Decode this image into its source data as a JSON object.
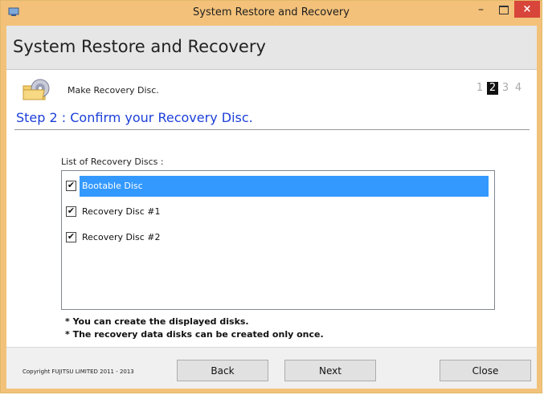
{
  "window": {
    "title": "System Restore and Recovery",
    "minimize_label": "–",
    "close_label": "×"
  },
  "header": {
    "heading": "System Restore and Recovery"
  },
  "section": {
    "label": "Make Recovery Disc.",
    "icon": "disc-folder-icon"
  },
  "steps": [
    {
      "label": "1",
      "active": false
    },
    {
      "label": "2",
      "active": true
    },
    {
      "label": "3",
      "active": false
    },
    {
      "label": "4",
      "active": false
    }
  ],
  "step_title": "Step 2 : Confirm your Recovery Disc.",
  "list": {
    "label": "List of Recovery Discs :",
    "items": [
      {
        "label": "Bootable Disc",
        "checked": true,
        "selected": true
      },
      {
        "label": "Recovery Disc #1",
        "checked": true,
        "selected": false
      },
      {
        "label": "Recovery Disc #2",
        "checked": true,
        "selected": false
      }
    ]
  },
  "notes": [
    "* You can create the displayed disks.",
    "* The recovery data disks can be created only once."
  ],
  "footer": {
    "copyright": "Copyright FUJITSU LIMITED 2011 - 2013",
    "back_label": "Back",
    "next_label": "Next",
    "close_label": "Close"
  },
  "colors": {
    "title_bar": "#f3c17a",
    "close_button": "#d8453a",
    "step_title": "#1c3fd8",
    "selection": "#3399ff"
  }
}
